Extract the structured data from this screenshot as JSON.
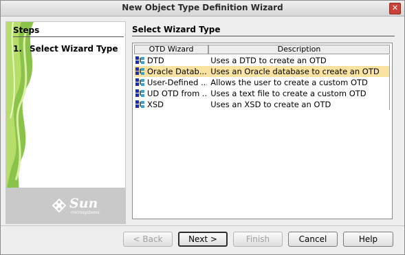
{
  "window": {
    "title": "New Object Type Definition Wizard",
    "close_glyph": "✕"
  },
  "steps": {
    "heading": "Steps",
    "items": [
      {
        "number": "1.",
        "label": "Select Wizard Type"
      }
    ]
  },
  "branding": {
    "logo_text": "Sun",
    "logo_subtext": "microsystems"
  },
  "main": {
    "heading": "Select Wizard Type",
    "columns": [
      "OTD Wizard",
      "Description"
    ],
    "rows": [
      {
        "wizard": "DTD",
        "description": "Uses a DTD to create an OTD",
        "icon": "tree-icon",
        "selected": false
      },
      {
        "wizard": "Oracle Datab...",
        "description": "Uses an Oracle database to create an OTD",
        "icon": "tree-icon",
        "selected": true
      },
      {
        "wizard": "User-Defined ...",
        "description": "Allows the user to create a custom OTD",
        "icon": "tree-icon",
        "selected": false
      },
      {
        "wizard": "UD OTD from ...",
        "description": "Uses a text file to create a custom OTD",
        "icon": "tree-icon",
        "selected": false
      },
      {
        "wizard": "XSD",
        "description": "Uses an XSD to create an OTD",
        "icon": "tree-icon",
        "selected": false
      }
    ]
  },
  "buttons": {
    "back": "< Back",
    "next": "Next >",
    "finish": "Finish",
    "cancel": "Cancel",
    "help": "Help"
  },
  "colors": {
    "selection": "#fae3a0",
    "accent_green": "#7fb53a"
  }
}
